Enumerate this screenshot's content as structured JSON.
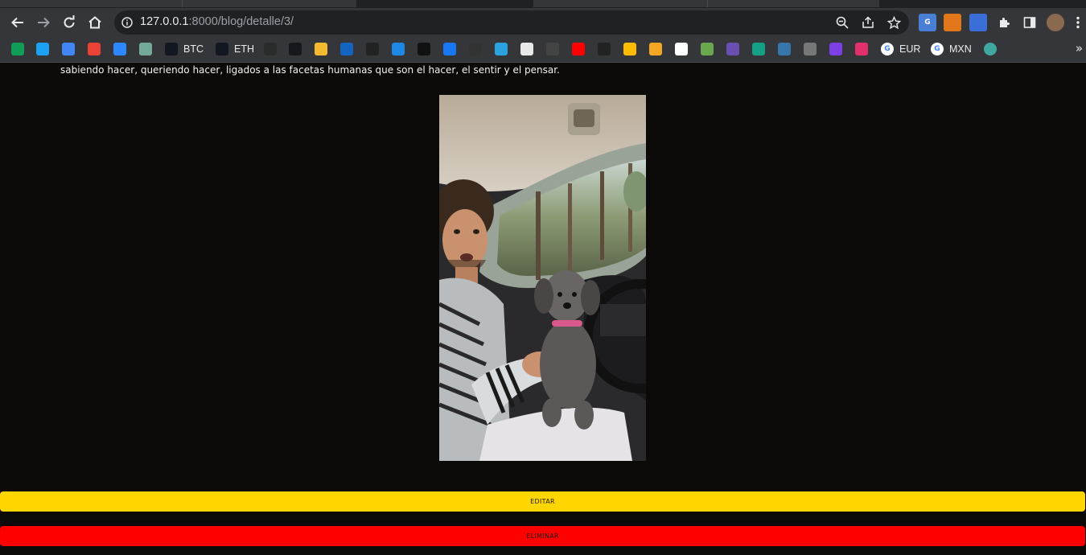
{
  "browser": {
    "url_host": "127.0.0.1",
    "url_rest": ":8000/blog/detalle/3/"
  },
  "bookmarks": [
    {
      "icon": "sheets-icon",
      "color": "#0f9d58",
      "label": ""
    },
    {
      "icon": "twitter-icon",
      "color": "#1da1f2",
      "label": ""
    },
    {
      "icon": "translate-icon",
      "color": "#4285f4",
      "label": ""
    },
    {
      "icon": "gmail-icon",
      "color": "#ea4335",
      "label": ""
    },
    {
      "icon": "messenger-icon",
      "color": "#2d88ff",
      "label": ""
    },
    {
      "icon": "chatgpt-icon",
      "color": "#74aa9c",
      "label": ""
    },
    {
      "icon": "tradingview-icon",
      "color": "#131722",
      "label": "BTC"
    },
    {
      "icon": "tradingview-icon",
      "color": "#131722",
      "label": "ETH"
    },
    {
      "icon": "app-icon",
      "color": "#2b2b2b",
      "label": ""
    },
    {
      "icon": "bybit-icon",
      "color": "#17181e",
      "label": ""
    },
    {
      "icon": "binance-icon",
      "color": "#f3ba2f",
      "label": ""
    },
    {
      "icon": "q-icon",
      "color": "#1565c0",
      "label": ""
    },
    {
      "icon": "app-icon",
      "color": "#222222",
      "label": ""
    },
    {
      "icon": "chart-icon",
      "color": "#1e88e5",
      "label": ""
    },
    {
      "icon": "app-icon",
      "color": "#111111",
      "label": ""
    },
    {
      "icon": "facebook-icon",
      "color": "#1877f2",
      "label": ""
    },
    {
      "icon": "investing-icon",
      "color": "#333333",
      "label": ""
    },
    {
      "icon": "telegram-icon",
      "color": "#2aa3df",
      "label": ""
    },
    {
      "icon": "app-icon",
      "color": "#e8e8e8",
      "label": ""
    },
    {
      "icon": "app-icon",
      "color": "#444444",
      "label": ""
    },
    {
      "icon": "youtube-icon",
      "color": "#ff0000",
      "label": ""
    },
    {
      "icon": "coder-icon",
      "color": "#222222",
      "label": ""
    },
    {
      "icon": "drive-icon",
      "color": "#fbbc04",
      "label": ""
    },
    {
      "icon": "infinity-icon",
      "color": "#f5a623",
      "label": ""
    },
    {
      "icon": "github-icon",
      "color": "#ffffff",
      "label": ""
    },
    {
      "icon": "frog-icon",
      "color": "#6aa84f",
      "label": ""
    },
    {
      "icon": "x-icon",
      "color": "#6a4fb3",
      "label": ""
    },
    {
      "icon": "w-icon",
      "color": "#14a085",
      "label": ""
    },
    {
      "icon": "python-icon",
      "color": "#3776ab",
      "label": ""
    },
    {
      "icon": "globe-icon",
      "color": "#777777",
      "label": ""
    },
    {
      "icon": "u-icon",
      "color": "#7b3fe4",
      "label": ""
    },
    {
      "icon": "instagram-icon",
      "color": "#e1306c",
      "label": ""
    },
    {
      "icon": "google-icon",
      "color": "#ffffff",
      "label": "EUR"
    },
    {
      "icon": "google-icon",
      "color": "#ffffff",
      "label": "MXN"
    },
    {
      "icon": "dot-icon",
      "color": "#3fa7a0",
      "label": ""
    }
  ],
  "post": {
    "text_line": "sabiendo hacer, queriendo hacer, ligados a las facetas humanas que son el hacer, el sentir y el pensar.",
    "edit_label": "EDITAR",
    "delete_label": "ELIMINAR"
  },
  "colors": {
    "edit": "#ffd600",
    "delete": "#ff0000",
    "background": "#0b0a09"
  }
}
